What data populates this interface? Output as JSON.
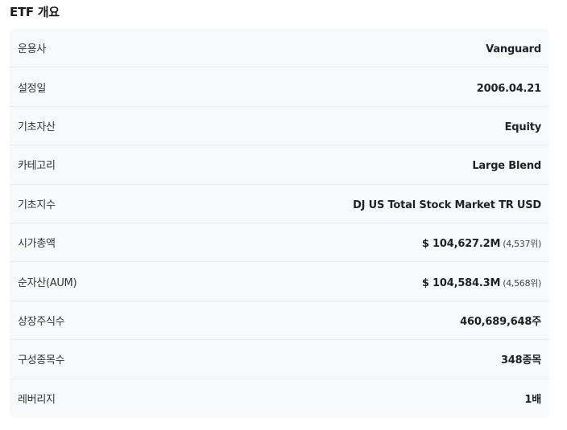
{
  "section": {
    "title": "ETF 개요"
  },
  "rows": [
    {
      "label": "운용사",
      "value": "Vanguard"
    },
    {
      "label": "설정일",
      "value": "2006.04.21"
    },
    {
      "label": "기초자산",
      "value": "Equity"
    },
    {
      "label": "카테고리",
      "value": "Large Blend"
    },
    {
      "label": "기초지수",
      "value": "DJ US Total Stock Market TR USD"
    },
    {
      "label": "시가총액",
      "value": "$ 104,627.2M",
      "rank": "(4,537위)"
    },
    {
      "label": "순자산(AUM)",
      "value": "$ 104,584.3M",
      "rank": "(4,568위)"
    },
    {
      "label": "상장주식수",
      "value": "460,689,648주"
    },
    {
      "label": "구성종목수",
      "value": "348종목"
    },
    {
      "label": "레버리지",
      "value": "1배"
    }
  ]
}
